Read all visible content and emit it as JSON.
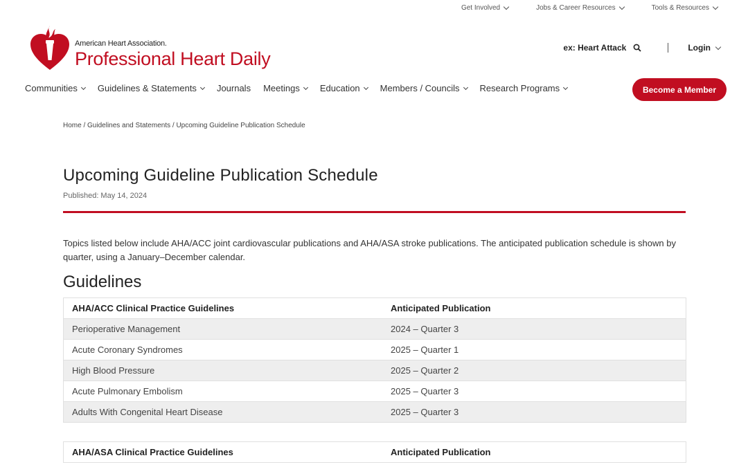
{
  "utility_nav": [
    {
      "label": "Get Involved"
    },
    {
      "label": "Jobs & Career Resources"
    },
    {
      "label": "Tools & Resources"
    }
  ],
  "logo": {
    "org_name": "American Heart Association.",
    "site_name": "Professional Heart Daily"
  },
  "search": {
    "label": "ex: Heart Attack"
  },
  "login": {
    "label": "Login"
  },
  "main_nav": [
    {
      "label": "Communities",
      "has_dropdown": true
    },
    {
      "label": "Guidelines & Statements",
      "has_dropdown": true
    },
    {
      "label": "Journals",
      "has_dropdown": false
    },
    {
      "label": "Meetings",
      "has_dropdown": true
    },
    {
      "label": "Education",
      "has_dropdown": true
    },
    {
      "label": "Members / Councils",
      "has_dropdown": true
    },
    {
      "label": "Research Programs",
      "has_dropdown": true
    }
  ],
  "cta": {
    "label": "Become a Member"
  },
  "breadcrumb": {
    "items": [
      "Home",
      "Guidelines and Statements",
      "Upcoming Guideline Publication Schedule"
    ],
    "separator": "/"
  },
  "page": {
    "title": "Upcoming Guideline Publication Schedule",
    "published": "Published: May 14, 2024",
    "intro": "Topics listed below include AHA/ACC joint cardiovascular publications and AHA/ASA stroke publications. The anticipated publication schedule is shown by quarter, using a January–December calendar.",
    "section_heading": "Guidelines"
  },
  "tables": [
    {
      "headers": [
        "AHA/ACC Clinical Practice Guidelines",
        "Anticipated Publication"
      ],
      "rows": [
        [
          "Perioperative Management",
          "2024 – Quarter 3"
        ],
        [
          "Acute Coronary Syndromes",
          "2025 – Quarter 1"
        ],
        [
          "High Blood Pressure",
          "2025 – Quarter 2"
        ],
        [
          "Acute Pulmonary Embolism",
          "2025 – Quarter 3"
        ],
        [
          "Adults With Congenital Heart Disease",
          "2025 – Quarter 3"
        ]
      ]
    },
    {
      "headers": [
        "AHA/ASA Clinical Practice Guidelines",
        "Anticipated Publication"
      ],
      "rows": []
    }
  ],
  "colors": {
    "brand_red": "#c10e21",
    "row_stripe": "#eeeeee"
  }
}
